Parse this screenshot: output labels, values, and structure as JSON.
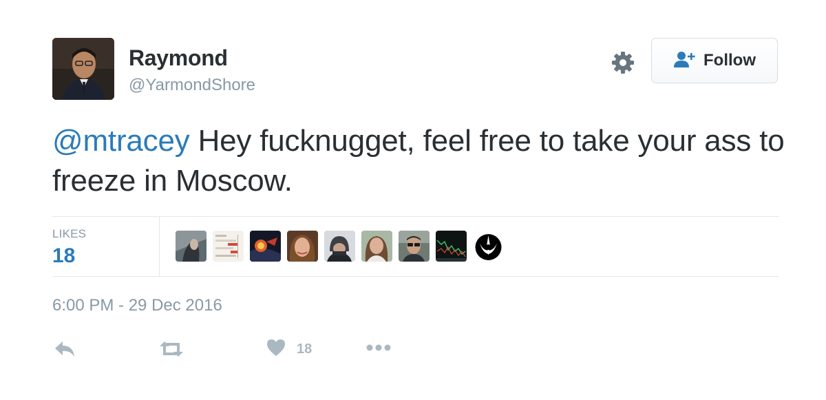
{
  "author": {
    "name": "Raymond",
    "handle": "@YarmondShore"
  },
  "header": {
    "follow_label": "Follow"
  },
  "tweet": {
    "mention": "@mtracey",
    "text": " Hey fucknugget, feel free to take your ass to freeze in Moscow."
  },
  "stats": {
    "likes_label": "LIKES",
    "likes_count": "18"
  },
  "likers": [
    {
      "icon": "liker-avatar-1"
    },
    {
      "icon": "liker-avatar-2"
    },
    {
      "icon": "liker-avatar-3"
    },
    {
      "icon": "liker-avatar-4"
    },
    {
      "icon": "liker-avatar-5"
    },
    {
      "icon": "liker-avatar-6"
    },
    {
      "icon": "liker-avatar-7"
    },
    {
      "icon": "liker-avatar-8"
    },
    {
      "icon": "rebel-alliance-icon"
    }
  ],
  "timestamp": "6:00 PM - 29 Dec 2016",
  "actions": {
    "reply_icon": "reply-icon",
    "retweet_icon": "retweet-icon",
    "like_icon": "heart-icon",
    "like_count": "18",
    "more_icon": "more-icon"
  },
  "colors": {
    "text": "#292f33",
    "muted": "#8899a6",
    "link": "#2b7bb9",
    "action": "#aab8c2",
    "divider": "#e1e8ed"
  }
}
